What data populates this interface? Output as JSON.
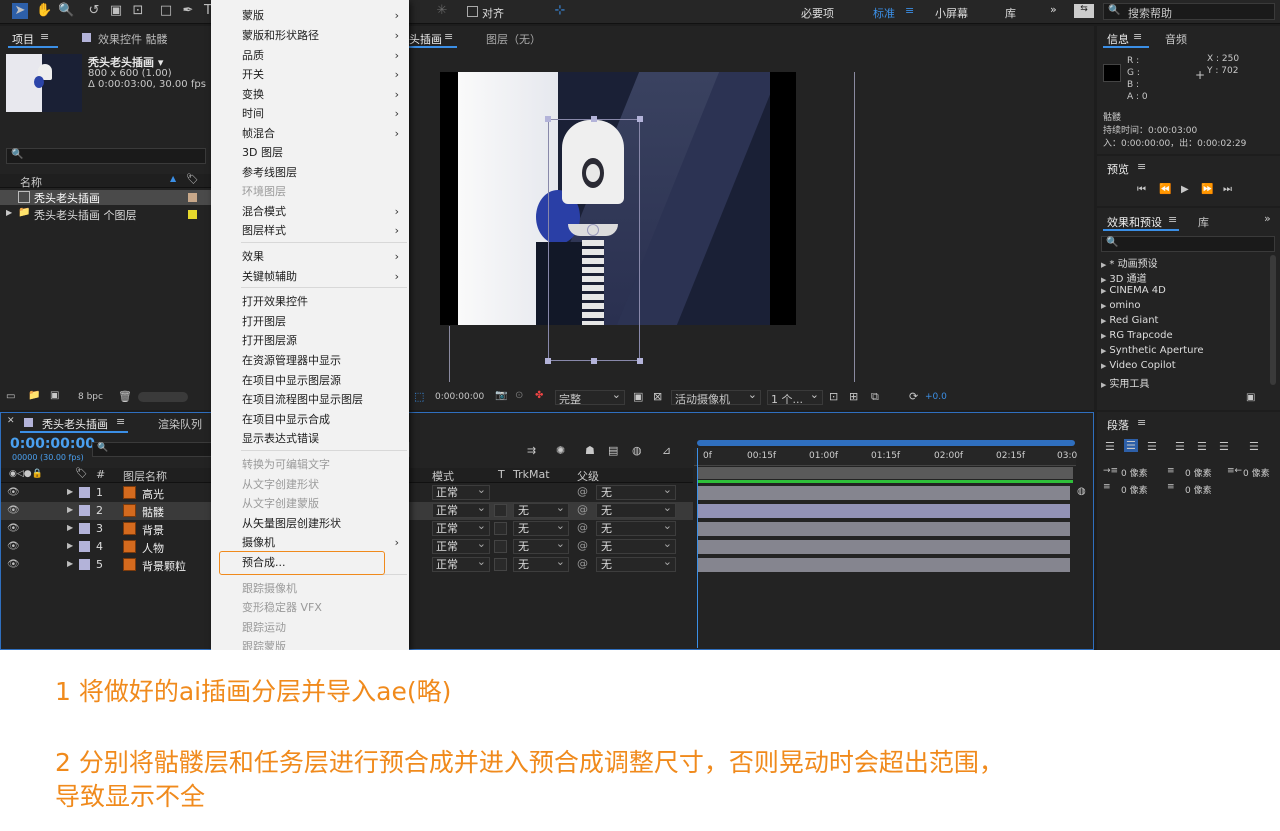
{
  "toolbar": {
    "align_label": "对齐",
    "workspace_essentials": "必要项",
    "workspace_standard": "标准",
    "workspace_small": "小屏幕",
    "workspace_lib": "库",
    "search_help_placeholder": "搜索帮助"
  },
  "project_panel": {
    "tab_project": "项目",
    "tab_effect_controls": "效果控件 骷髅",
    "comp_name": "秃头老头插画 ▾",
    "comp_size": "800 x 600 (1.00)",
    "comp_duration": "Δ 0:00:03:00, 30.00 fps",
    "col_name": "名称",
    "items": [
      {
        "name": "秃头老头插画"
      },
      {
        "name": "秃头老头插画 个图层"
      }
    ],
    "bpc": "8 bpc"
  },
  "composition_panel": {
    "tab_comp": "头插画",
    "tab_layer": "图层（无）",
    "timecode": "0:00:00:00",
    "resolution": "完整",
    "camera": "活动摄像机",
    "views": "1 个...",
    "exposure": "+0.0"
  },
  "info_panel": {
    "tab_info": "信息",
    "tab_audio": "音频",
    "r": "R :",
    "g": "G :",
    "b": "B :",
    "a": "A : 0",
    "x": "X : 250",
    "y": "Y : 702",
    "layer_name": "骷髅",
    "duration": "持续时间：0:00:03:00",
    "in_out": "入：0:00:00:00，出：0:00:02:29"
  },
  "preview_panel": {
    "title": "预览"
  },
  "effects_panel": {
    "tab_effects": "效果和预设",
    "tab_lib": "库",
    "categories": [
      "* 动画预设",
      "3D 通道",
      "CINEMA 4D",
      "omino",
      "Red Giant",
      "RG Trapcode",
      "Synthetic Aperture",
      "Video Copilot",
      "实用工具"
    ]
  },
  "paragraph_panel": {
    "title": "段落",
    "px": "0 像素"
  },
  "timeline": {
    "tab_comp": "秃头老头插画",
    "tab_render": "渲染队列",
    "timecode": "0:00:00:00",
    "frame_info": "00000 (30.00 fps)",
    "col_layer_name": "图层名称",
    "col_mode": "模式",
    "col_t": "T",
    "col_trkmat": "TrkMat",
    "col_parent": "父级",
    "ticks": [
      "0f",
      "00:15f",
      "01:00f",
      "01:15f",
      "02:00f",
      "02:15f",
      "03:0"
    ],
    "layers": [
      {
        "num": "1",
        "name": "高光",
        "mode": "正常",
        "trkmat": "",
        "parent": "无"
      },
      {
        "num": "2",
        "name": "骷髅",
        "mode": "正常",
        "trkmat": "无",
        "parent": "无"
      },
      {
        "num": "3",
        "name": "背景",
        "mode": "正常",
        "trkmat": "无",
        "parent": "无"
      },
      {
        "num": "4",
        "name": "人物",
        "mode": "正常",
        "trkmat": "无",
        "parent": "无"
      },
      {
        "num": "5",
        "name": "背景颗粒",
        "mode": "正常",
        "trkmat": "无",
        "parent": "无"
      }
    ]
  },
  "context_menu": {
    "items": [
      {
        "label": "蒙版",
        "sub": true
      },
      {
        "label": "蒙版和形状路径",
        "sub": true
      },
      {
        "label": "品质",
        "sub": true
      },
      {
        "label": "开关",
        "sub": true
      },
      {
        "label": "变换",
        "sub": true
      },
      {
        "label": "时间",
        "sub": true
      },
      {
        "label": "帧混合",
        "sub": true
      },
      {
        "label": "3D 图层"
      },
      {
        "label": "参考线图层"
      },
      {
        "label": "环境图层",
        "disabled": true
      },
      {
        "label": "混合模式",
        "sub": true
      },
      {
        "label": "图层样式",
        "sub": true
      },
      {
        "label": "效果",
        "sub": true
      },
      {
        "label": "关键帧辅助",
        "sub": true
      },
      {
        "label": "打开效果控件"
      },
      {
        "label": "打开图层"
      },
      {
        "label": "打开图层源"
      },
      {
        "label": "在资源管理器中显示"
      },
      {
        "label": "在项目中显示图层源"
      },
      {
        "label": "在项目流程图中显示图层"
      },
      {
        "label": "在项目中显示合成"
      },
      {
        "label": "显示表达式错误"
      },
      {
        "label": "转换为可编辑文字",
        "disabled": true
      },
      {
        "label": "从文字创建形状",
        "disabled": true
      },
      {
        "label": "从文字创建蒙版",
        "disabled": true
      },
      {
        "label": "从矢量图层创建形状"
      },
      {
        "label": "摄像机",
        "sub": true
      },
      {
        "label": "预合成..."
      },
      {
        "label": "跟踪摄像机",
        "disabled": true
      },
      {
        "label": "变形稳定器 VFX",
        "disabled": true
      },
      {
        "label": "跟踪运动",
        "disabled": true
      },
      {
        "label": "跟踪蒙版",
        "disabled": true
      }
    ]
  },
  "captions": {
    "line1": "1 将做好的ai插画分层并导入ae(略)",
    "line2": "2 分别将骷髅层和任务层进行预合成并进入预合成调整尺寸，否则晃动时会超出范围，",
    "line3": "导致显示不全"
  },
  "colors": {
    "accent": "#3b8fe6",
    "orange": "#f08a1c",
    "timecode": "#4aa0f0"
  }
}
